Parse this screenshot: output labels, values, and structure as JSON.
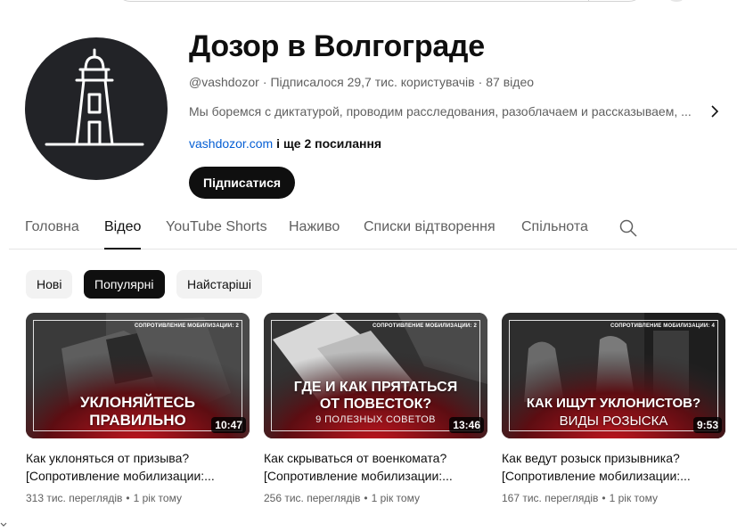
{
  "channel": {
    "title": "Дозор в Волгограде",
    "handle": "@vashdozor",
    "subscribers": "Підписалося 29,7 тис. користувачів",
    "videos_count": "87 відео",
    "description": "Мы боремся с диктатурой, проводим расследования, разоблачаем и рассказываем, ...",
    "link_text": "vashdozor.com",
    "more_links": "і ще 2 посилання",
    "subscribe_label": "Підписатися"
  },
  "tabs": [
    {
      "label": "Головна"
    },
    {
      "label": "Відео"
    },
    {
      "label": "YouTube Shorts"
    },
    {
      "label": "Наживо"
    },
    {
      "label": "Списки відтворення"
    },
    {
      "label": "Спільнота"
    }
  ],
  "active_tab": "Відео",
  "chips": [
    {
      "label": "Нові"
    },
    {
      "label": "Популярні"
    },
    {
      "label": "Найстаріші"
    }
  ],
  "selected_chip": "Популярні",
  "videos": [
    {
      "thumb_series": "СОПРОТИВЛЕНИЕ МОБИЛИЗАЦИИ: 2",
      "thumb_line1": "УКЛОНЯЙТЕСЬ",
      "thumb_line2": "ПРАВИЛЬНО",
      "thumb_sub": "",
      "duration": "10:47",
      "title": "Как уклоняться от призыва? [Сопротивление мобилизации:...",
      "views": "313 тис. переглядів",
      "age": "1 рік тому"
    },
    {
      "thumb_series": "СОПРОТИВЛЕНИЕ МОБИЛИЗАЦИИ: 2",
      "thumb_line1": "ГДЕ И КАК ПРЯТАТЬСЯ",
      "thumb_line2": "ОТ ПОВЕСТОК?",
      "thumb_sub": "9 ПОЛЕЗНЫХ СОВЕТОВ",
      "duration": "13:46",
      "title": "Как скрываться от военкомата? [Сопротивление мобилизации:...",
      "views": "256 тис. переглядів",
      "age": "1 рік тому"
    },
    {
      "thumb_series": "СОПРОТИВЛЕНИЕ МОБИЛИЗАЦИИ: 4",
      "thumb_line1": "КАК ИЩУТ УКЛОНИСТОВ?",
      "thumb_line2": "ВИДЫ РОЗЫСКА",
      "thumb_sub": "",
      "duration": "9:53",
      "title": "Как ведут розыск призывника? [Сопротивление мобилизации:...",
      "views": "167 тис. переглядів",
      "age": "1 рік тому"
    }
  ],
  "icons": {
    "avatar": "lighthouse-logo",
    "description_more": "chevron-right-icon",
    "tab_search": "search-icon"
  },
  "colors": {
    "subscribe_bg": "#0f0f0f",
    "link": "#065fd4",
    "thumb_red": "#b3121b",
    "avatar_bg": "#222327"
  }
}
